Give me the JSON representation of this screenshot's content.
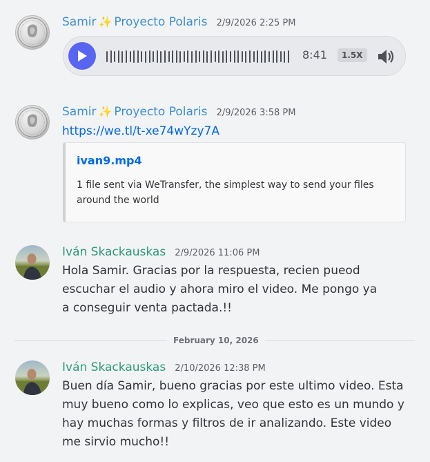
{
  "messages": [
    {
      "author": "Samir",
      "author_suffix": "Proyecto Polaris",
      "sparkle": "✨",
      "timestamp": "2/9/2026 2:25 PM",
      "audio": {
        "duration": "8:41",
        "speed": "1.5X"
      }
    },
    {
      "author": "Samir",
      "author_suffix": "Proyecto Polaris",
      "sparkle": "✨",
      "timestamp": "2/9/2026 3:58 PM",
      "link": "https://we.tl/t-xe74wYzy7A",
      "embed": {
        "title": "ivan9.mp4",
        "description": "1 file sent via WeTransfer, the simplest way to send your files around the world"
      }
    },
    {
      "author": "Iván Skackauskas",
      "timestamp": "2/9/2026 11:06 PM",
      "text": "Hola Samir. Gracias por la respuesta, recien pueod escuchar el audio y ahora miro el video. Me pongo ya a conseguir venta pactada.!!"
    },
    {
      "author": "Iván Skackauskas",
      "timestamp": "2/10/2026 12:38 PM",
      "text": "Buen día Samir, bueno gracias por este ultimo video. Esta muy bueno como lo explicas, veo que esto es un mundo y hay muchas formas y filtros de ir analizando. Este video me sirvio mucho!!"
    }
  ],
  "date_divider": "February 10, 2026",
  "colors": {
    "background": "#f2f3f5",
    "samir_name": "#3d8fd0",
    "ivan_name": "#2b9a77",
    "link": "#0068e0",
    "play_button": "#5865f2"
  },
  "icons": [
    "coin-avatar",
    "person-avatar",
    "play-icon",
    "speaker-icon",
    "sparkle-icon"
  ]
}
